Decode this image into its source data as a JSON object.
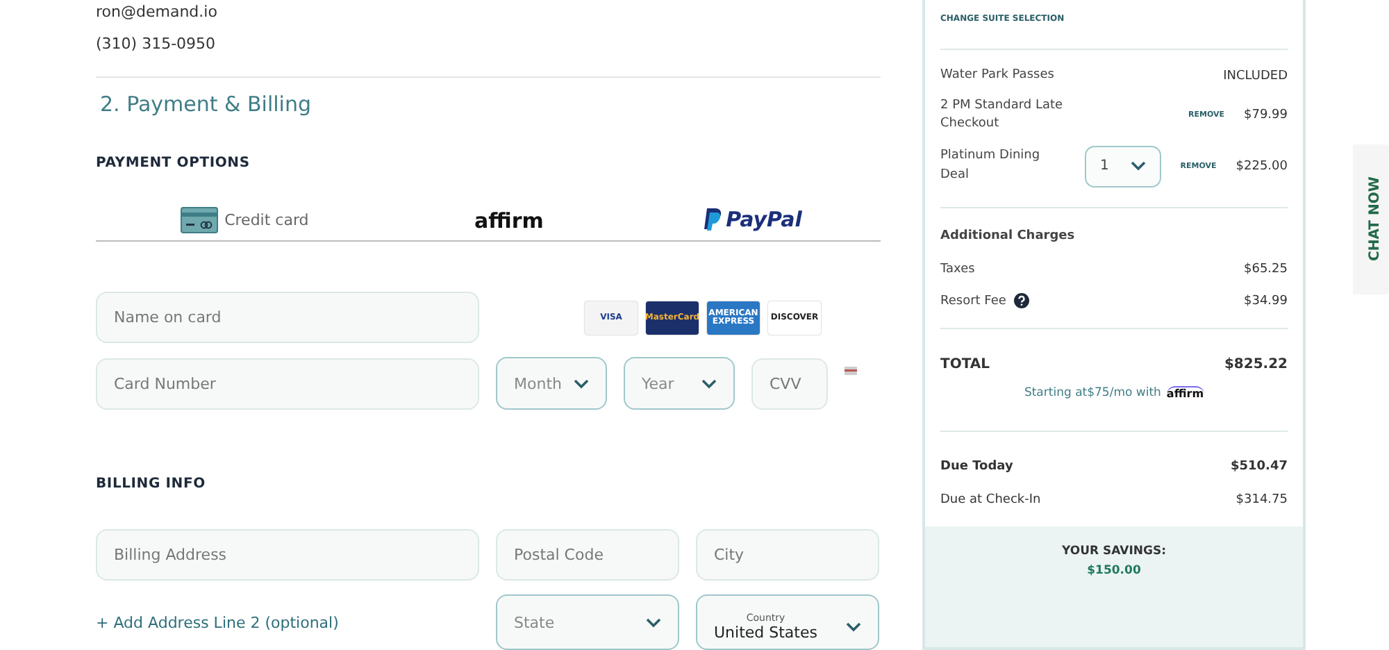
{
  "contact": {
    "email": "ron@demand.io",
    "phone": "(310) 315-0950"
  },
  "section_title": "2. Payment & Billing",
  "payment_options": {
    "heading": "PAYMENT OPTIONS",
    "methods": [
      {
        "kind": "card",
        "label": "Credit card",
        "selected": true
      },
      {
        "kind": "affirm",
        "label": "affirm",
        "selected": false
      },
      {
        "kind": "paypal",
        "label": "PayPal",
        "selected": false
      }
    ]
  },
  "card_form": {
    "name_placeholder": "Name on card",
    "card_logos": [
      {
        "kind": "visa",
        "label": "VISA"
      },
      {
        "kind": "mastercard",
        "label": "MasterCard"
      },
      {
        "kind": "amex",
        "label": "AMERICAN EXPRESS"
      },
      {
        "kind": "discover",
        "label": "DISCOVER"
      }
    ],
    "number_placeholder": "Card Number",
    "month_placeholder": "Month",
    "year_placeholder": "Year",
    "cvv_placeholder": "CVV"
  },
  "billing": {
    "heading": "BILLING INFO",
    "address_placeholder": "Billing Address",
    "postal_placeholder": "Postal Code",
    "city_placeholder": "City",
    "add_line_link": "+ Add Address Line 2 (optional)",
    "state_placeholder": "State",
    "country_label": "Country",
    "country_value": "United States"
  },
  "summary": {
    "change_link": "CHANGE SUITE SELECTION",
    "lines": [
      {
        "kind": "included",
        "label": "Water Park Passes",
        "value": "INCLUDED"
      },
      {
        "kind": "removable",
        "label": "2 PM Standard Late Checkout",
        "remove": "REMOVE",
        "value": "$79.99"
      },
      {
        "kind": "quantity",
        "label": "Platinum Dining Deal",
        "quantity": "1",
        "remove": "REMOVE",
        "value": "$225.00"
      }
    ],
    "additional_heading": "Additional Charges",
    "charges": [
      {
        "label": "Taxes",
        "value": "$65.25",
        "info": false
      },
      {
        "label": "Resort Fee",
        "value": "$34.99",
        "info": true
      }
    ],
    "total_label": "TOTAL",
    "total_value": "$825.22",
    "financing": {
      "text": "Starting at$75/mo with",
      "brand": "affirm"
    },
    "due": [
      {
        "label": "Due Today",
        "value": "$510.47",
        "bold": true
      },
      {
        "label": "Due at Check-In",
        "value": "$314.75",
        "bold": false
      }
    ],
    "savings": {
      "label": "YOUR SAVINGS:",
      "value": "$150.00"
    }
  },
  "chat": "CHAT NOW"
}
